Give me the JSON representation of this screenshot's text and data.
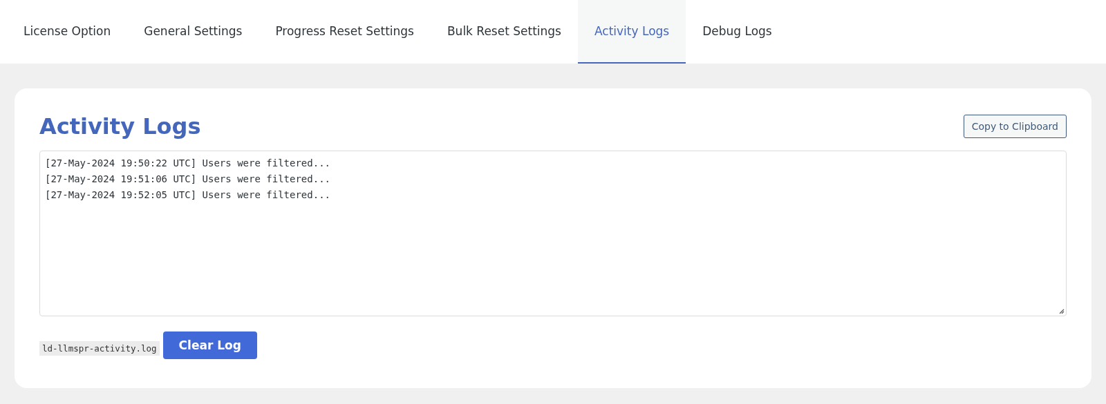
{
  "tabs": [
    {
      "label": "License Option",
      "selected": false
    },
    {
      "label": "General Settings",
      "selected": false
    },
    {
      "label": "Progress Reset Settings",
      "selected": false
    },
    {
      "label": "Bulk Reset Settings",
      "selected": false
    },
    {
      "label": "Activity Logs",
      "selected": true
    },
    {
      "label": "Debug Logs",
      "selected": false
    }
  ],
  "panel": {
    "title": "Activity Logs",
    "copy_button": "Copy to Clipboard",
    "log_lines": [
      "[27-May-2024 19:50:22 UTC] Users were filtered...",
      "[27-May-2024 19:51:06 UTC] Users were filtered...",
      "[27-May-2024 19:52:05 UTC] Users were filtered..."
    ],
    "file_name": "ld-llmspr-activity.log",
    "clear_button": "Clear Log"
  }
}
